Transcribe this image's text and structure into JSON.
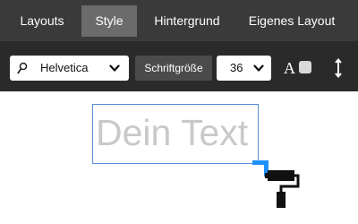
{
  "tabs": [
    {
      "label": "Layouts",
      "active": false
    },
    {
      "label": "Style",
      "active": true
    },
    {
      "label": "Hintergrund",
      "active": false
    },
    {
      "label": "Eigenes Layout",
      "active": false
    }
  ],
  "toolbar": {
    "font": {
      "value": "Helvetica",
      "icon": "search-icon"
    },
    "font_size_label": "Schriftgröße",
    "font_size": {
      "value": "36"
    },
    "text_color": {
      "glyph": "A",
      "swatch_color": "#d9d9d9"
    },
    "line_height_icon": "vertical-resize-icon"
  },
  "canvas": {
    "text": "Dein Text",
    "text_color": "#c9c9c9",
    "frame_color": "#5b8fd6",
    "handle_color": "#1e90ff",
    "tool_icon": "paint-roller-icon"
  }
}
